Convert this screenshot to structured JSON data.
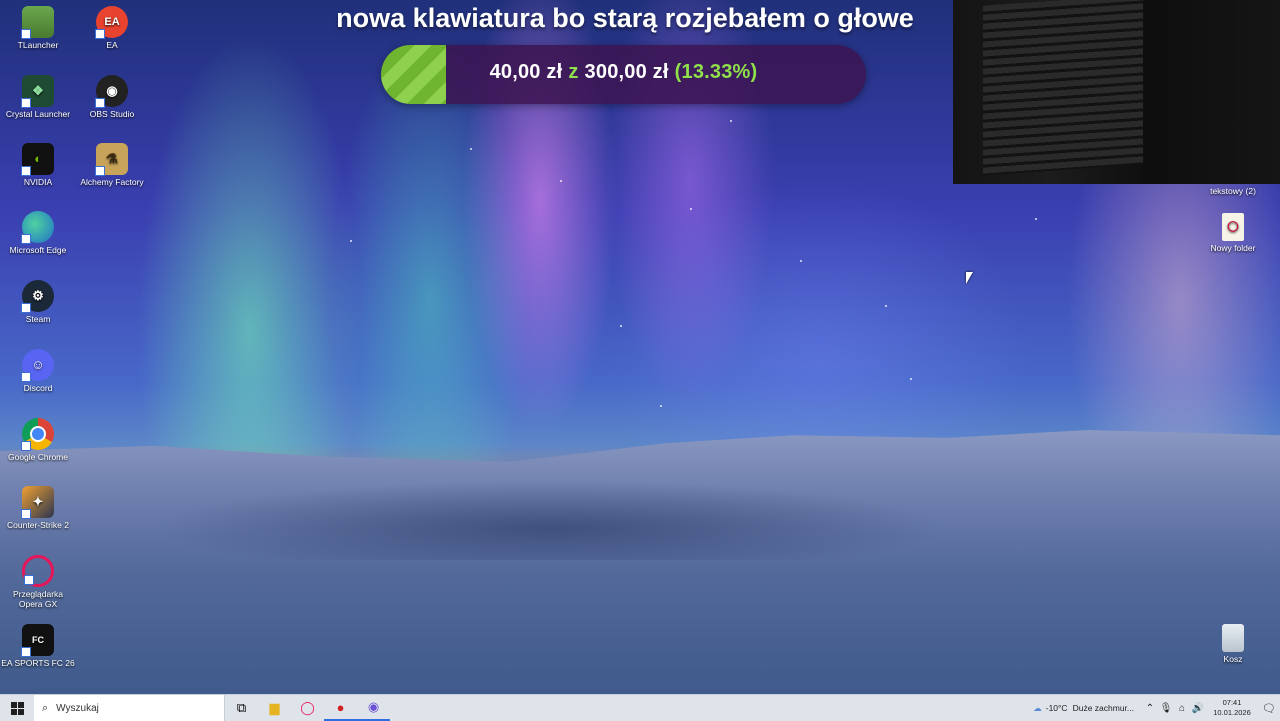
{
  "overlay": {
    "title": "nowa klawiatura bo starą rozjebałem o głowe",
    "amount": "40,00 zł",
    "separator": "z",
    "goal": "300,00 zł",
    "percent_label": "(13.33%)",
    "progress_fraction": 0.1333,
    "fill_color": "#8fd14f"
  },
  "desktop": {
    "icons_left": [
      {
        "label": "TLauncher",
        "icon": "tlauncher-icon"
      },
      {
        "label": "EA",
        "icon": "ea-icon"
      },
      {
        "label": "Crystal Launcher",
        "icon": "crystal-launcher-icon"
      },
      {
        "label": "OBS Studio",
        "icon": "obs-icon"
      },
      {
        "label": "NVIDIA",
        "icon": "nvidia-icon"
      },
      {
        "label": "Alchemy Factory",
        "icon": "alchemy-factory-icon"
      },
      {
        "label": "Microsoft Edge",
        "icon": "edge-icon"
      },
      {
        "label": "Steam",
        "icon": "steam-icon"
      },
      {
        "label": "Discord",
        "icon": "discord-icon"
      },
      {
        "label": "Google Chrome",
        "icon": "chrome-icon"
      },
      {
        "label": "Counter-Strike 2",
        "icon": "cs2-icon"
      },
      {
        "label": "Przeglądarka Opera GX",
        "icon": "opera-gx-icon"
      },
      {
        "label": "EA SPORTS FC 26",
        "icon": "fc26-icon"
      }
    ],
    "icons_right": [
      {
        "label": "tekstowy (2)",
        "icon": "text-file-icon"
      },
      {
        "label": "Nowy folder",
        "icon": "folder-icon"
      },
      {
        "label": "Kosz",
        "icon": "recycle-bin-icon"
      }
    ]
  },
  "taskbar": {
    "search_placeholder": "Wyszukaj",
    "weather_temp": "-10°C",
    "weather_text": "Duże zachmur...",
    "time": "07:41",
    "date": "10.01.2026"
  }
}
